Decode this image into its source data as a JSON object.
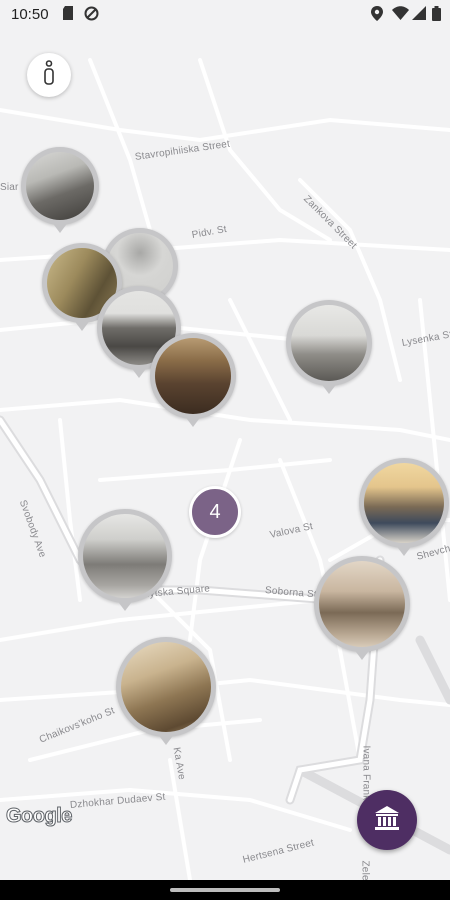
{
  "status_bar": {
    "time": "10:50",
    "left_icons": [
      "sd-card-icon",
      "no-disturb-icon"
    ],
    "right_icons": [
      "location-icon",
      "wifi-icon",
      "signal-icon",
      "battery-icon"
    ]
  },
  "map": {
    "streets": [
      "Stavropihiiska Street",
      "Pidv. St",
      "Zankova Street",
      "Lysenka St",
      "Svobody Ave",
      "Valova St",
      "Halytska Square",
      "Soborna St",
      "Chaikovs'koho St",
      "Dzhokhar Dudaev St",
      "Hertsena Street",
      "Ivana Franka St",
      "Shevchenka",
      "Zelen",
      "Siar",
      "Ka Ave"
    ],
    "cluster_count": "4",
    "attribution": "Google"
  },
  "controls": {
    "info_icon": "info-icon",
    "fab_icon": "museum-icon"
  },
  "colors": {
    "accent": "#4e2e63",
    "cluster": "#7b6387",
    "pin_ring": "#c6c6c8",
    "map_bg": "#f2f2f3",
    "road": "#ffffff",
    "major_road": "#dcdcde"
  }
}
